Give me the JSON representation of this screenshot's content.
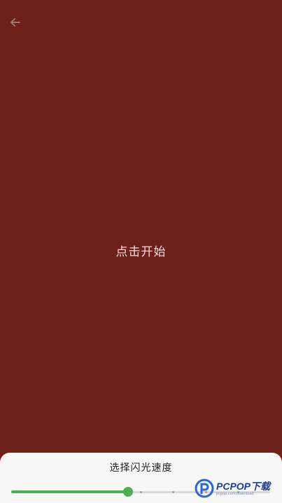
{
  "header": {
    "back_icon": "arrow-left-icon"
  },
  "main": {
    "start_label": "点击开始"
  },
  "speed_panel": {
    "title": "选择闪光速度",
    "slider": {
      "value_fraction": 0.45,
      "tick_count": 8,
      "accent_color": "#4caf50"
    }
  },
  "watermark": {
    "brand": "PCPOP下载",
    "sub": "pcpop.com/download"
  },
  "colors": {
    "background": "#6e201b",
    "sheet": "#f7f7f7",
    "accent": "#4caf50"
  }
}
